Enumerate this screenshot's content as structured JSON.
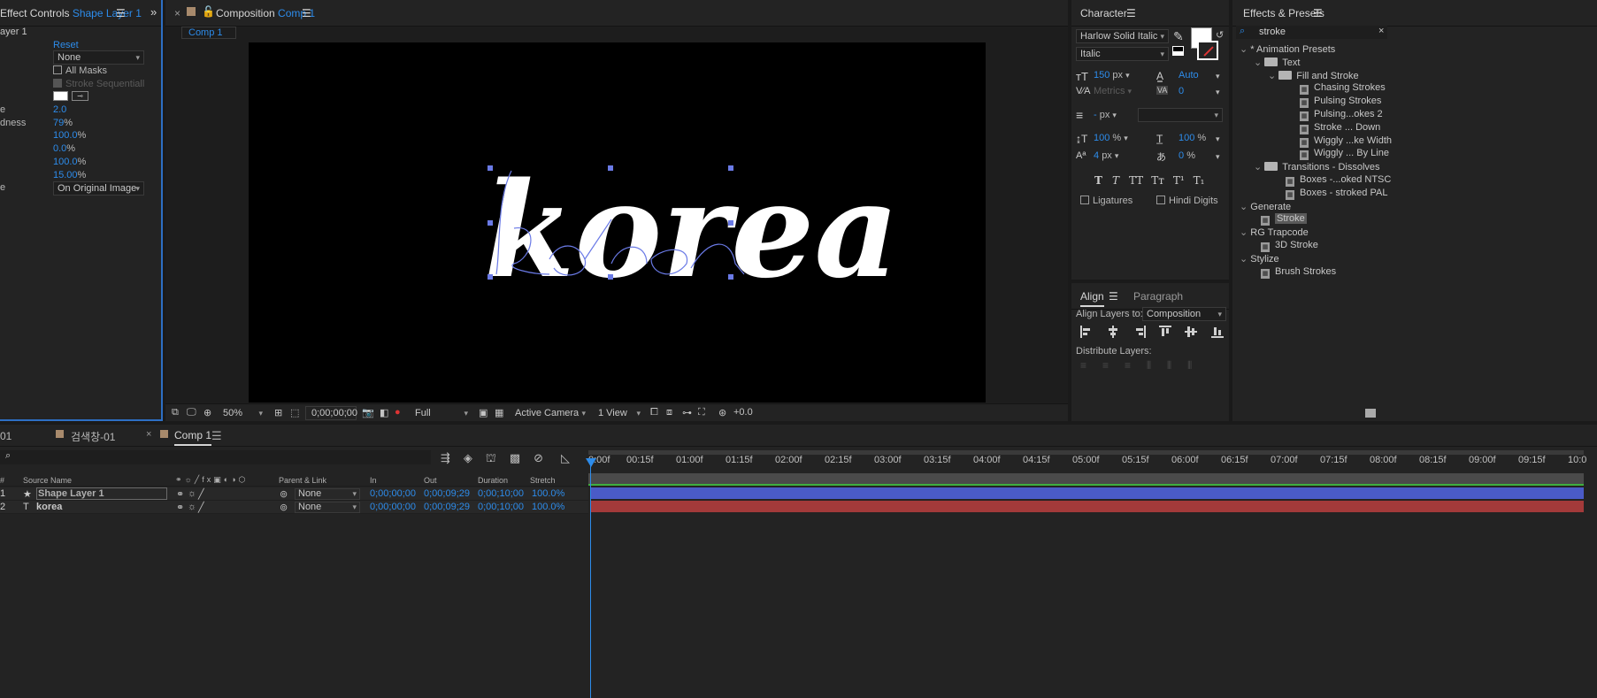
{
  "effect_controls": {
    "title_prefix": "Effect Controls",
    "title_layer": "Shape Layer 1",
    "layer_label": "ayer 1",
    "reset": "Reset",
    "path_value": "None",
    "all_masks": "All Masks",
    "stroke_sequentially": "Stroke Sequentiall",
    "brush_size_value": "2.0",
    "hardness_label": "dness",
    "hardness_value": "79",
    "percent": "%",
    "opacity_value": "100.0",
    "start_value": "0.0",
    "end_value": "100.0",
    "spacing_value": "15.00",
    "paint_style_value": "On Original Image",
    "row_e_label": "e",
    "row_e2_label": "e"
  },
  "composition": {
    "title_prefix": "Composition",
    "title_comp": "Comp 1",
    "tab": "Comp 1",
    "text": "korea",
    "bottom_bar": {
      "zoom": "50%",
      "timecode": "0;00;00;00",
      "resolution": "Full",
      "camera": "Active Camera",
      "view": "1 View",
      "exposure": "+0.0"
    }
  },
  "character": {
    "title": "Character",
    "font": "Harlow Solid Italic",
    "style": "Italic",
    "size": "150",
    "size_unit": "px",
    "leading": "Auto",
    "kerning": "Metrics",
    "tracking": "0",
    "stroke_width": "-",
    "stroke_unit": "px",
    "vscale": "100",
    "hscale": "100",
    "baseline": "4",
    "baseline_unit": "px",
    "tsume": "0",
    "pct": "%",
    "styles": [
      "T",
      "T",
      "TT",
      "Tт",
      "T¹",
      "T₁"
    ],
    "ligatures": "Ligatures",
    "hindi_digits": "Hindi Digits"
  },
  "align": {
    "tab_align": "Align",
    "tab_paragraph": "Paragraph",
    "align_to_label": "Align Layers to:",
    "align_to_value": "Composition",
    "distribute_label": "Distribute Layers:"
  },
  "effects_presets": {
    "title": "Effects & Presets",
    "search_value": "stroke",
    "items": [
      {
        "label": "* Animation Presets",
        "kind": "group",
        "level": 0
      },
      {
        "label": "Text",
        "kind": "folder",
        "level": 1
      },
      {
        "label": "Fill and Stroke",
        "kind": "folder",
        "level": 2
      },
      {
        "label": "Chasing Strokes",
        "kind": "preset",
        "level": 3
      },
      {
        "label": "Pulsing Strokes",
        "kind": "preset",
        "level": 3
      },
      {
        "label": "Pulsing...okes 2",
        "kind": "preset",
        "level": 3
      },
      {
        "label": "Stroke ... Down",
        "kind": "preset",
        "level": 3
      },
      {
        "label": "Wiggly ...ke Width",
        "kind": "preset",
        "level": 3
      },
      {
        "label": "Wiggly ... By Line",
        "kind": "preset",
        "level": 3
      },
      {
        "label": "Transitions - Dissolves",
        "kind": "folder",
        "level": 1
      },
      {
        "label": "Boxes -...oked NTSC",
        "kind": "preset",
        "level": 2
      },
      {
        "label": "Boxes - stroked PAL",
        "kind": "preset",
        "level": 2
      },
      {
        "label": "Generate",
        "kind": "group",
        "level": 0
      },
      {
        "label": "Stroke",
        "kind": "effect",
        "level": 1,
        "selected": true
      },
      {
        "label": "RG Trapcode",
        "kind": "group",
        "level": 0
      },
      {
        "label": "3D Stroke",
        "kind": "effect",
        "level": 1
      },
      {
        "label": "Stylize",
        "kind": "group",
        "level": 0
      },
      {
        "label": "Brush Strokes",
        "kind": "effect",
        "level": 1
      }
    ]
  },
  "timeline": {
    "tab_left": "01",
    "tab_search": "검색창-01",
    "tab_comp": "Comp 1",
    "columns": {
      "source_name": "Source Name",
      "parent_link": "Parent & Link",
      "in": "In",
      "out": "Out",
      "duration": "Duration",
      "stretch": "Stretch"
    },
    "layers": [
      {
        "num": "1",
        "type_icon": "★",
        "name": "Shape Layer 1",
        "parent": "None",
        "in": "0;00;00;00",
        "out": "0;00;09;29",
        "duration": "0;00;10;00",
        "stretch": "100.0%",
        "bar_color": "#4a5bc7"
      },
      {
        "num": "2",
        "type_icon": "T",
        "name": "korea",
        "parent": "None",
        "in": "0;00;00;00",
        "out": "0;00;09;29",
        "duration": "0;00;10;00",
        "stretch": "100.0%",
        "bar_color": "#a33a3a"
      }
    ],
    "ruler": [
      "0:00f",
      "00:15f",
      "01:00f",
      "01:15f",
      "02:00f",
      "02:15f",
      "03:00f",
      "03:15f",
      "04:00f",
      "04:15f",
      "05:00f",
      "05:15f",
      "06:00f",
      "06:15f",
      "07:00f",
      "07:15f",
      "08:00f",
      "08:15f",
      "09:00f",
      "09:15f",
      "10:0"
    ],
    "row_mark": "#"
  },
  "colors": {
    "accent": "#2d8ceb",
    "work_area": "#3a3a3a"
  }
}
